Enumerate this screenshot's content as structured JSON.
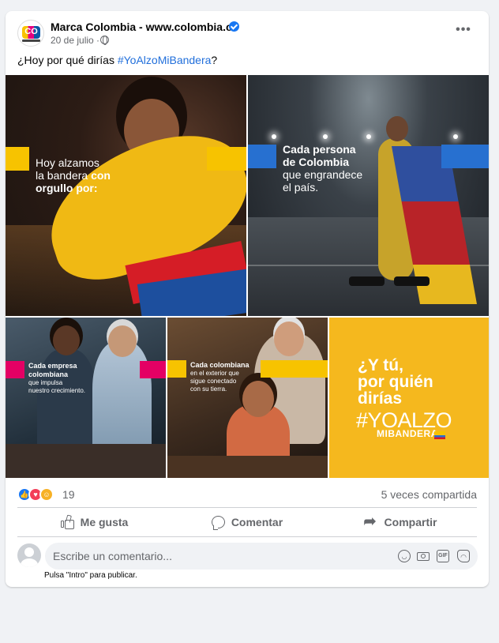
{
  "post": {
    "page_name": "Marca Colombia - www.colombia.co",
    "date": "20 de julio · ",
    "caption_text": "¿Hoy por qué dirías ",
    "caption_hashtag": "#YoAlzoMiBandera",
    "caption_end": "?",
    "avatar_logo": "CO"
  },
  "images": {
    "tile1": {
      "line1": "Hoy alzamos",
      "line2a": "la bandera ",
      "line2b": "con",
      "line3": "orgullo por:"
    },
    "tile2": {
      "line1": "Cada persona",
      "line2": "de Colombia",
      "line3": "que engrandece",
      "line4": "el país."
    },
    "tile3": {
      "line1": "Cada empresa",
      "line2": "colombiana",
      "line3": "que impulsa",
      "line4": "nuestro crecimiento."
    },
    "tile4": {
      "line1": "Cada colombiana",
      "line2": "en el exterior que",
      "line3": "sigue conectado",
      "line4": "con su tierra."
    },
    "tile5": {
      "line1": "¿Y tú,",
      "line2": "por quién",
      "line3": "dirías",
      "hashtag": "#YOALZO",
      "sub": "MIBANDERA"
    }
  },
  "stats": {
    "reaction_count": "19",
    "shares": "5 veces compartida"
  },
  "actions": {
    "like": "Me gusta",
    "comment": "Comentar",
    "share": "Compartir"
  },
  "comment": {
    "placeholder": "Escribe un comentario...",
    "hint": "Pulsa \"Intro\" para publicar.",
    "gif_label": "GIF"
  },
  "colors": {
    "accent_link": "#216fdb",
    "flag_yellow": "#f7c300",
    "flag_blue": "#2770d0",
    "flag_red": "#d51d26"
  }
}
